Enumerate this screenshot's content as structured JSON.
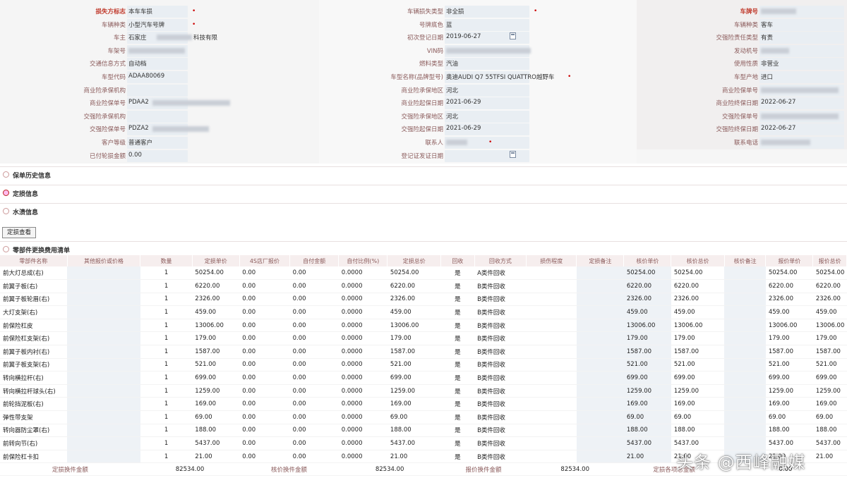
{
  "info": {
    "col1": [
      {
        "label": "损失方标志",
        "value": "本车车损",
        "req": true,
        "hl": true
      },
      {
        "label": "车辆种类",
        "value": "小型汽车号牌",
        "req": true
      },
      {
        "label": "车主",
        "value": "石家庄",
        "blur2": "科技有限",
        "req": false
      },
      {
        "label": "车架号",
        "value": "",
        "blur": 80
      },
      {
        "label": "交通信息方式",
        "value": "自动档"
      },
      {
        "label": "车型代码",
        "value": "ADAA80069"
      },
      {
        "label": "商业险承保机构",
        "value": ""
      },
      {
        "label": "商业险保单号",
        "value": "PDAA2",
        "blur": 110
      },
      {
        "label": "交强险承保机构",
        "value": ""
      },
      {
        "label": "交强险保单号",
        "value": "PDZA2",
        "blur": 80
      },
      {
        "label": "客户等级",
        "value": "普通客户"
      },
      {
        "label": "已付轮损金额",
        "value": "0.00"
      }
    ],
    "col2": [
      {
        "label": "车辆损失类型",
        "value": "非全损",
        "req": true
      },
      {
        "label": "号牌底色",
        "value": "蓝"
      },
      {
        "label": "初次登记日期",
        "value": "2019-06-27",
        "cal": true
      },
      {
        "label": "VIN码",
        "value": "",
        "blur": 120
      },
      {
        "label": "燃料类型",
        "value": "汽油"
      },
      {
        "label": "车型名称(品牌型号)",
        "value": "奥迪AUDI Q7 55TFSI QUATTRO越野车",
        "dot": true
      },
      {
        "label": "商业险承保地区",
        "value": "河北"
      },
      {
        "label": "商业险起保日期",
        "value": "2021-06-29"
      },
      {
        "label": "交强险承保地区",
        "value": "河北"
      },
      {
        "label": "交强险起保日期",
        "value": "2021-06-29"
      },
      {
        "label": "联系人",
        "value": "",
        "blur": 30,
        "dot": true
      },
      {
        "label": "登记证发证日期",
        "value": "",
        "cal": true
      }
    ],
    "col3": [
      {
        "label": "车牌号",
        "value": "",
        "blur": 50,
        "req": true,
        "hl": true
      },
      {
        "label": "车辆种类",
        "value": "客车"
      },
      {
        "label": "交强险责任类型",
        "value": "有责",
        "req": true
      },
      {
        "label": "发动机号",
        "value": "",
        "blur": 40
      },
      {
        "label": "使用性质",
        "value": "非营业",
        "req": true
      },
      {
        "label": "车型产地",
        "value": "进口"
      },
      {
        "label": "商业险保单号",
        "value": "",
        "blur": 110
      },
      {
        "label": "商业险终保日期",
        "value": "2022-06-27"
      },
      {
        "label": "交强险保单号",
        "value": "",
        "blur": 110
      },
      {
        "label": "交强险终保日期",
        "value": "2022-06-27"
      },
      {
        "label": "联系电话",
        "value": "",
        "blur": 70
      }
    ]
  },
  "sections": [
    {
      "title": "保单历史信息",
      "active": false
    },
    {
      "title": "定损信息",
      "active": true
    },
    {
      "title": "水渍信息",
      "active": false
    }
  ],
  "detail_button": "定损查看",
  "parts_section_title": "零部件更换费用清单",
  "table": {
    "headers": [
      "零部件名称",
      "其他报价或价格",
      "数量",
      "定损单价",
      "4S店厂报价",
      "自付金额",
      "自付比例(%)",
      "定损总价",
      "回收",
      "回收方式",
      "损伤程度",
      "定损备注",
      "核价单价",
      "核价总价",
      "核价备注",
      "报价单价",
      "报价总价"
    ],
    "rows": [
      [
        "前大灯总成(右)",
        "",
        "1",
        "50254.00",
        "0.00",
        "0.00",
        "0.0000",
        "50254.00",
        "是",
        "A类件回收",
        "",
        "",
        "50254.00",
        "50254.00",
        "",
        "50254.00",
        "50254.00"
      ],
      [
        "前翼子板(右)",
        "",
        "1",
        "6220.00",
        "0.00",
        "0.00",
        "0.0000",
        "6220.00",
        "是",
        "B类件回收",
        "",
        "",
        "6220.00",
        "6220.00",
        "",
        "6220.00",
        "6220.00"
      ],
      [
        "前翼子板轮眉(右)",
        "",
        "1",
        "2326.00",
        "0.00",
        "0.00",
        "0.0000",
        "2326.00",
        "是",
        "B类件回收",
        "",
        "",
        "2326.00",
        "2326.00",
        "",
        "2326.00",
        "2326.00"
      ],
      [
        "大灯支架(右)",
        "",
        "1",
        "459.00",
        "0.00",
        "0.00",
        "0.0000",
        "459.00",
        "是",
        "B类件回收",
        "",
        "",
        "459.00",
        "459.00",
        "",
        "459.00",
        "459.00"
      ],
      [
        "前保险杠皮",
        "",
        "1",
        "13006.00",
        "0.00",
        "0.00",
        "0.0000",
        "13006.00",
        "是",
        "B类件回收",
        "",
        "",
        "13006.00",
        "13006.00",
        "",
        "13006.00",
        "13006.00"
      ],
      [
        "前保险杠支架(右)",
        "",
        "1",
        "179.00",
        "0.00",
        "0.00",
        "0.0000",
        "179.00",
        "是",
        "B类件回收",
        "",
        "",
        "179.00",
        "179.00",
        "",
        "179.00",
        "179.00"
      ],
      [
        "前翼子板内衬(右)",
        "",
        "1",
        "1587.00",
        "0.00",
        "0.00",
        "0.0000",
        "1587.00",
        "是",
        "B类件回收",
        "",
        "",
        "1587.00",
        "1587.00",
        "",
        "1587.00",
        "1587.00"
      ],
      [
        "前翼子板支架(右)",
        "",
        "1",
        "521.00",
        "0.00",
        "0.00",
        "0.0000",
        "521.00",
        "是",
        "B类件回收",
        "",
        "",
        "521.00",
        "521.00",
        "",
        "521.00",
        "521.00"
      ],
      [
        "转向横拉杆(右)",
        "",
        "1",
        "699.00",
        "0.00",
        "0.00",
        "0.0000",
        "699.00",
        "是",
        "B类件回收",
        "",
        "",
        "699.00",
        "699.00",
        "",
        "699.00",
        "699.00"
      ],
      [
        "转向横拉杆球头(右)",
        "",
        "1",
        "1259.00",
        "0.00",
        "0.00",
        "0.0000",
        "1259.00",
        "是",
        "B类件回收",
        "",
        "",
        "1259.00",
        "1259.00",
        "",
        "1259.00",
        "1259.00"
      ],
      [
        "前轮挡泥板(右)",
        "",
        "1",
        "169.00",
        "0.00",
        "0.00",
        "0.0000",
        "169.00",
        "是",
        "B类件回收",
        "",
        "",
        "169.00",
        "169.00",
        "",
        "169.00",
        "169.00"
      ],
      [
        "弹性带支架",
        "",
        "1",
        "69.00",
        "0.00",
        "0.00",
        "0.0000",
        "69.00",
        "是",
        "B类件回收",
        "",
        "",
        "69.00",
        "69.00",
        "",
        "69.00",
        "69.00"
      ],
      [
        "转向器防尘罩(右)",
        "",
        "1",
        "188.00",
        "0.00",
        "0.00",
        "0.0000",
        "188.00",
        "是",
        "B类件回收",
        "",
        "",
        "188.00",
        "188.00",
        "",
        "188.00",
        "188.00"
      ],
      [
        "前转向节(右)",
        "",
        "1",
        "5437.00",
        "0.00",
        "0.00",
        "0.0000",
        "5437.00",
        "是",
        "B类件回收",
        "",
        "",
        "5437.00",
        "5437.00",
        "",
        "5437.00",
        "5437.00"
      ],
      [
        "前保险杠卡扣",
        "",
        "1",
        "21.00",
        "0.00",
        "0.00",
        "0.0000",
        "21.00",
        "是",
        "B类件回收",
        "",
        "",
        "21.00",
        "21.00",
        "",
        "21.00",
        "21.00"
      ]
    ],
    "totals": [
      {
        "label": "定损换件金额",
        "value": "82534.00"
      },
      {
        "label": "核价换件金额",
        "value": "82534.00"
      },
      {
        "label": "报价换件金额",
        "value": "82534.00"
      },
      {
        "label": "定损各项总金额",
        "value": "0.00"
      }
    ]
  },
  "watermark": "头条 @西峰融媒"
}
